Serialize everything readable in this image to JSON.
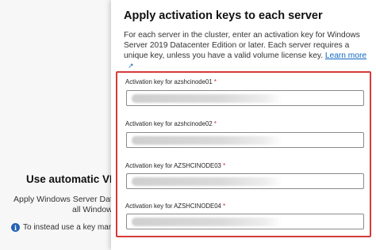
{
  "background": {
    "title": "Use automatic VM",
    "description_line1": "Apply Windows Server Datacer",
    "description_line2": "all Windows",
    "info_text": "To instead use a key manag"
  },
  "panel": {
    "title": "Apply activation keys to each server",
    "description": "For each server in the cluster, enter an activation key for Windows Server 2019 Datacenter Edition or later. Each server requires a unique key, unless you have a valid volume license key.",
    "learn_more": "Learn more",
    "fields": [
      {
        "label": "Activation key for azshcinode01",
        "required": "*",
        "value": ""
      },
      {
        "label": "Activation key for azshcinode02",
        "required": "*",
        "value": ""
      },
      {
        "label": "Activation key for AZSHCINODE03",
        "required": "*",
        "value": ""
      },
      {
        "label": "Activation key for AZSHCINODE04",
        "required": "*",
        "value": ""
      }
    ]
  },
  "colors": {
    "highlight_border": "#d83a3a",
    "link": "#0f66c2",
    "required": "#c4262e",
    "info_icon": "#2462b4"
  },
  "icons": [
    "info-icon",
    "external-link-icon"
  ]
}
